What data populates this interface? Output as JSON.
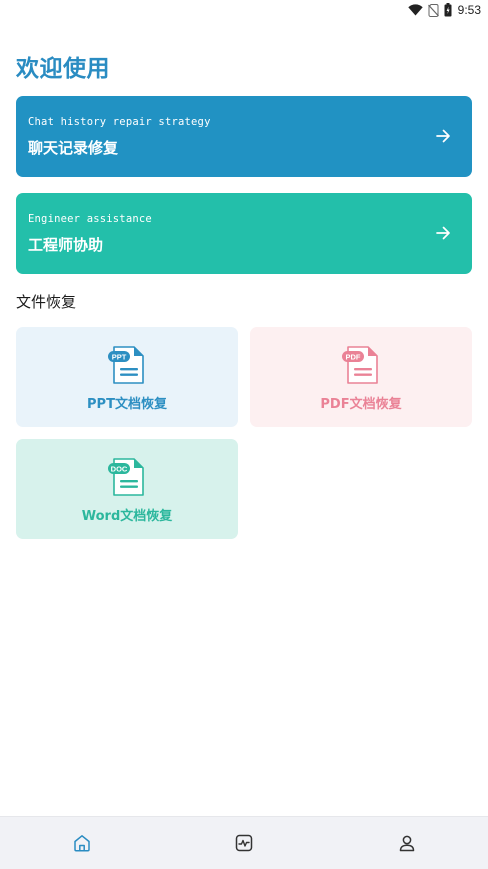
{
  "status_bar": {
    "time": "9:53",
    "icons": [
      "wifi-icon",
      "no-sim-icon",
      "battery-icon"
    ]
  },
  "page": {
    "title": "欢迎使用"
  },
  "feature_cards": [
    {
      "subtitle": "Chat history repair strategy",
      "title": "聊天记录修复",
      "color": "#2192c3",
      "icon": "arrow-right-icon"
    },
    {
      "subtitle": "Engineer assistance",
      "title": "工程师协助",
      "color": "#23bfaa",
      "icon": "arrow-right-icon"
    }
  ],
  "file_recovery": {
    "section_title": "文件恢复",
    "tiles": [
      {
        "label": "PPT文档恢复",
        "badge": "PPT",
        "color": "#2d8fc2",
        "background": "#e9f3fa",
        "icon": "ppt-file-icon"
      },
      {
        "label": "PDF文档恢复",
        "badge": "PDF",
        "color": "#ea8296",
        "background": "#fdf0f1",
        "icon": "pdf-file-icon"
      },
      {
        "label": "Word文档恢复",
        "badge": "DOC",
        "color": "#2cb79d",
        "background": "#d7f2ec",
        "icon": "doc-file-icon"
      }
    ]
  },
  "bottom_nav": {
    "items": [
      {
        "icon": "home-icon",
        "active": true
      },
      {
        "icon": "activity-chart-icon",
        "active": false
      },
      {
        "icon": "user-profile-icon",
        "active": false
      }
    ],
    "active_color": "#2a8cc2"
  }
}
